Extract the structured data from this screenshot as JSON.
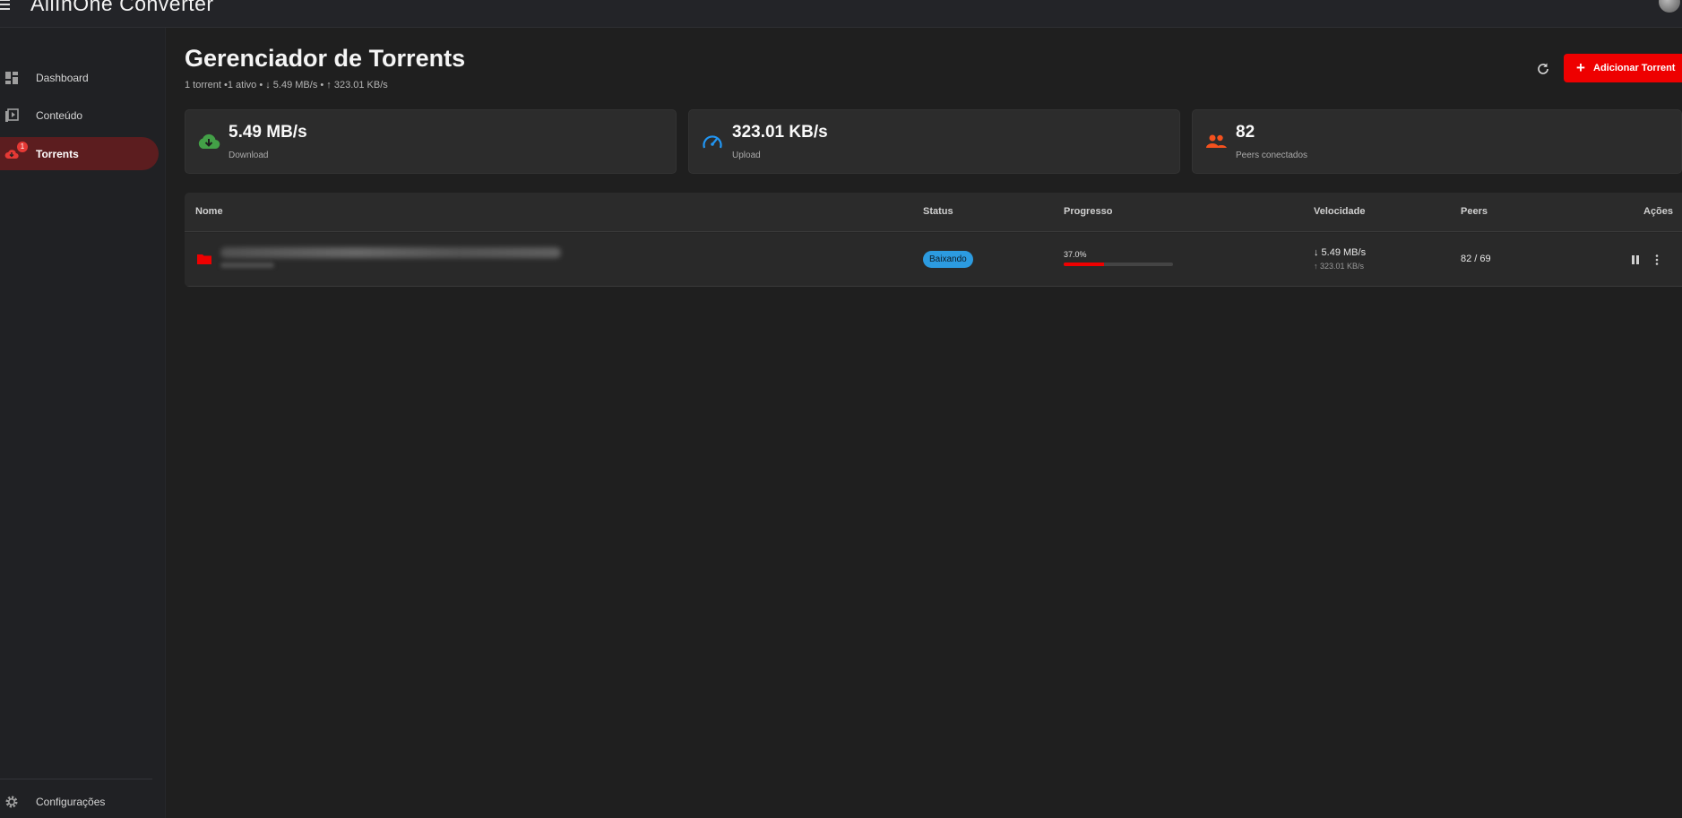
{
  "app": {
    "brand": "AllInOne Converter"
  },
  "sidebar": {
    "items": [
      {
        "label": "Dashboard",
        "icon": "dashboard-icon"
      },
      {
        "label": "Conteúdo",
        "icon": "video-library-icon"
      },
      {
        "label": "Torrents",
        "icon": "cloud-download-icon",
        "active": true,
        "badge": "1"
      }
    ],
    "settings_label": "Configurações"
  },
  "header": {
    "title": "Gerenciador de Torrents",
    "subtitle": "1 torrent •1 ativo • ↓ 5.49 MB/s • ↑ 323.01 KB/s",
    "add_button": "Adicionar Torrent"
  },
  "stats": [
    {
      "value": "5.49 MB/s",
      "label": "Download",
      "icon": "cloud-download-icon",
      "color": "#43a047"
    },
    {
      "value": "323.01 KB/s",
      "label": "Upload",
      "icon": "speedometer-icon",
      "color": "#2196f3"
    },
    {
      "value": "82",
      "label": "Peers conectados",
      "icon": "people-icon",
      "color": "#f4511e"
    }
  ],
  "table": {
    "headers": [
      "Nome",
      "Status",
      "Progresso",
      "Velocidade",
      "Peers",
      "Ações"
    ],
    "rows": [
      {
        "status": "Baixando",
        "progress_text": "37.0%",
        "progress": 0.37,
        "speed_down": "↓ 5.49 MB/s",
        "speed_up": "↑ 323.01 KB/s",
        "peers": "82 / 69"
      }
    ]
  },
  "colors": {
    "accent": "#ee0000",
    "status_downloading": "#2c9be0"
  }
}
